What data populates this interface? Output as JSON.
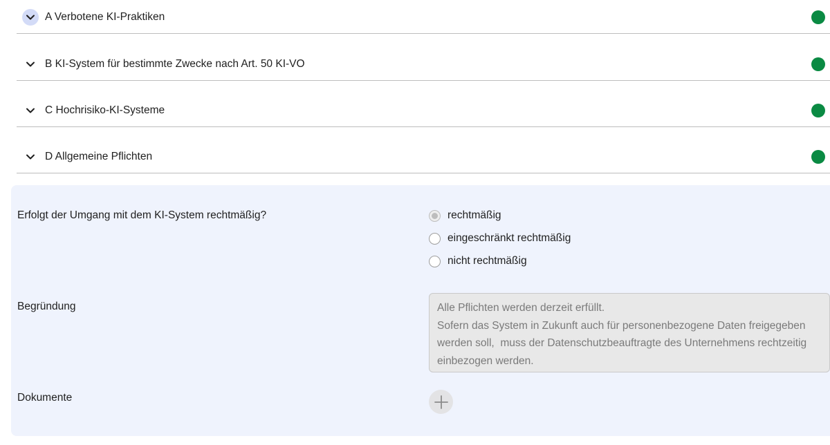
{
  "sections": [
    {
      "label": "A Verbotene KI-Praktiken",
      "status_color": "#0a8a43",
      "expanded": true
    },
    {
      "label": "B KI-System für bestimmte Zwecke nach Art. 50 KI-VO",
      "status_color": "#0a8a43",
      "expanded": false
    },
    {
      "label": "C Hochrisiko-KI-Systeme",
      "status_color": "#0a8a43",
      "expanded": false
    },
    {
      "label": "D Allgemeine Pflichten",
      "status_color": "#0a8a43",
      "expanded": false
    }
  ],
  "panel": {
    "question": "Erfolgt der Umgang mit dem KI-System rechtmäßig?",
    "options": [
      {
        "label": "rechtmäßig",
        "checked": true
      },
      {
        "label": "eingeschränkt rechtmäßig",
        "checked": false
      },
      {
        "label": "nicht rechtmäßig",
        "checked": false
      }
    ],
    "reason_label": "Begründung",
    "reason_lines": [
      "Alle Pflichten werden derzeit erfüllt.",
      "Sofern das System in Zukunft auch für personenbezogene Daten freigegeben",
      "werden soll,  muss der Datenschutzbeauftragte des Unternehmens rechtzeitig",
      "einbezogen werden."
    ],
    "documents_label": "Dokumente",
    "add_icon": "plus-icon"
  },
  "colors": {
    "status_ok": "#0a8a43",
    "panel_bg": "#eff3fd",
    "chevron_active_bg": "#d3dbf7"
  }
}
